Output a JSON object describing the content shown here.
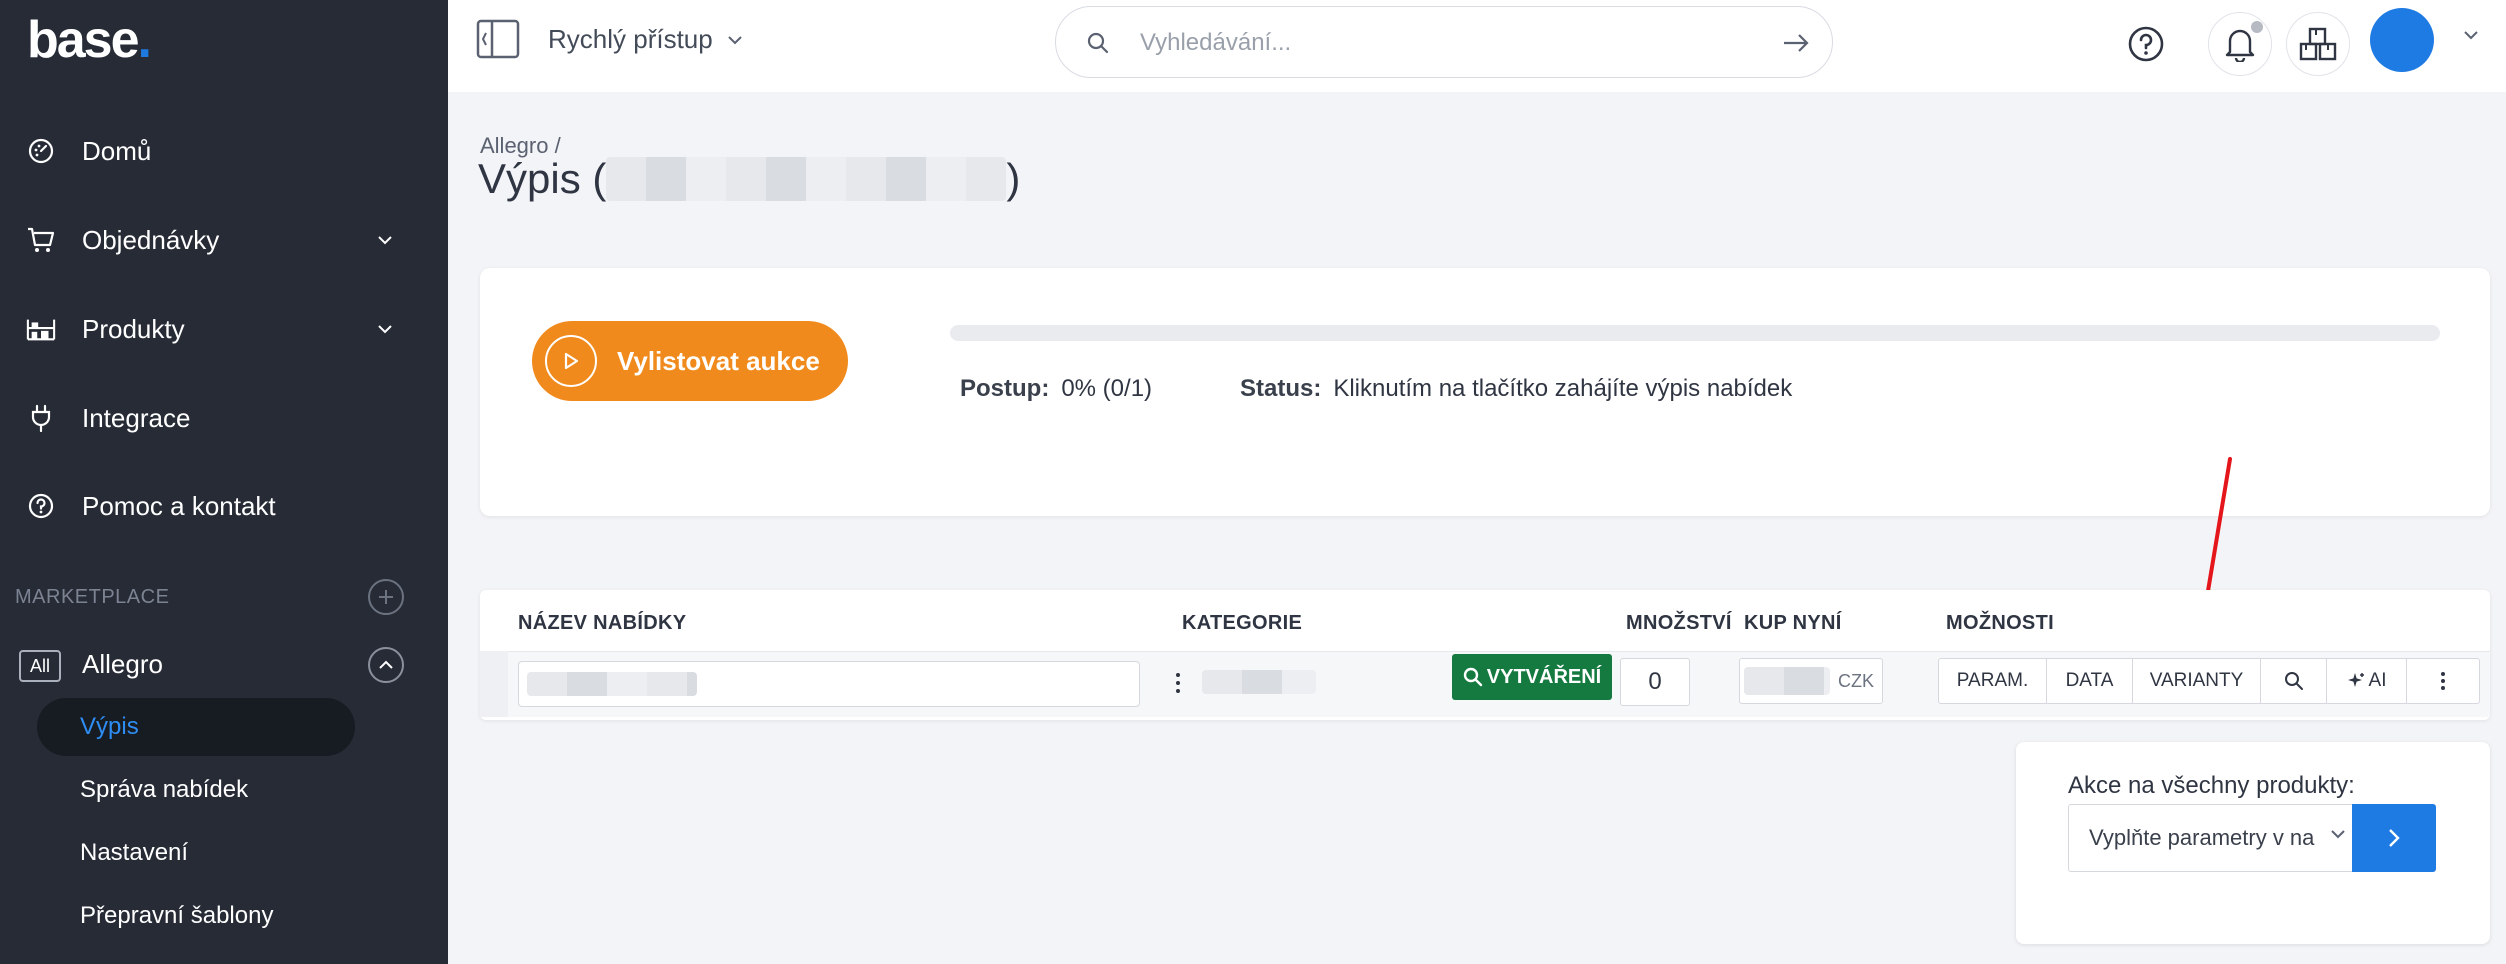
{
  "app": {
    "logo_text": "base",
    "logo_dot": "."
  },
  "sidebar": {
    "items": [
      {
        "label": "Domů",
        "icon": "dashboard-icon"
      },
      {
        "label": "Objednávky",
        "icon": "cart-icon",
        "expandable": true
      },
      {
        "label": "Produkty",
        "icon": "warehouse-icon",
        "expandable": true
      },
      {
        "label": "Integrace",
        "icon": "plug-icon"
      },
      {
        "label": "Pomoc a kontakt",
        "icon": "help-circle-icon"
      }
    ],
    "marketplace_label": "MARKETPLACE",
    "marketplace": {
      "badge": "All",
      "name": "Allegro",
      "subitems": [
        {
          "label": "Výpis",
          "active": true
        },
        {
          "label": "Správa nabídek",
          "active": false
        },
        {
          "label": "Nastavení",
          "active": false
        },
        {
          "label": "Přepravní šablony",
          "active": false
        }
      ]
    }
  },
  "topbar": {
    "quick_access": "Rychlý přístup",
    "search_placeholder": "Vyhledávání..."
  },
  "page": {
    "breadcrumb": "Allegro /",
    "title_prefix": "Výpis (",
    "title_suffix": ")"
  },
  "listing": {
    "start_button": "Vylistovat aukce",
    "progress_label": "Postup:",
    "progress_value": "0% (0/1)",
    "progress_fraction": 0,
    "status_label": "Status:",
    "status_value": "Kliknutím na tlačítko zahájíte výpis nabídek"
  },
  "table": {
    "headers": {
      "name": "NÁZEV NABÍDKY",
      "category": "KATEGORIE",
      "quantity": "MNOŽSTVÍ",
      "buy_now": "KUP NYNÍ",
      "options": "MOŽNOSTI"
    },
    "row": {
      "create_button": "VYTVÁŘENÍ",
      "quantity": "0",
      "currency": "CZK",
      "options": [
        "PARAM.",
        "DATA",
        "VARIANTY",
        "",
        "AI",
        ""
      ]
    }
  },
  "bulk": {
    "label": "Akce na všechny produkty:",
    "selected": "Vyplňte parametry v na"
  },
  "colors": {
    "sidebar_bg": "#262b36",
    "accent_blue": "#1e7be3",
    "orange": "#f08a1c",
    "green": "#147a3f",
    "annotation_red": "#e5161b"
  }
}
